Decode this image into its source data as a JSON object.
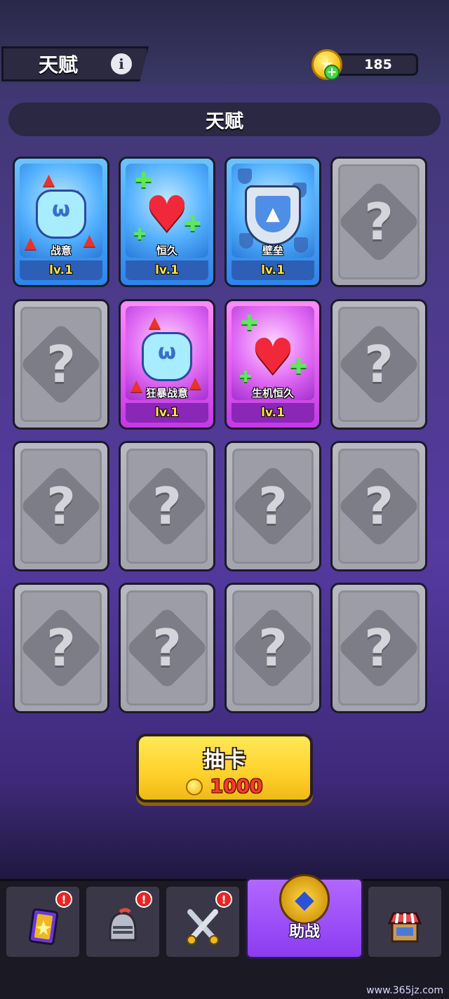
{
  "header": {
    "title": "天赋",
    "coins": "185"
  },
  "section": {
    "title": "天赋"
  },
  "cards": [
    {
      "name": "战意",
      "level": "lv.1",
      "rarity": "blue",
      "art": "fist"
    },
    {
      "name": "恒久",
      "level": "lv.1",
      "rarity": "blue",
      "art": "heart"
    },
    {
      "name": "壁垒",
      "level": "lv.1",
      "rarity": "blue",
      "art": "shield"
    },
    {
      "name": "",
      "level": "",
      "rarity": "locked",
      "art": "question"
    },
    {
      "name": "",
      "level": "",
      "rarity": "locked",
      "art": "question"
    },
    {
      "name": "狂暴战意",
      "level": "lv.1",
      "rarity": "purple",
      "art": "fist"
    },
    {
      "name": "生机恒久",
      "level": "lv.1",
      "rarity": "purple",
      "art": "heart"
    },
    {
      "name": "",
      "level": "",
      "rarity": "locked",
      "art": "question"
    },
    {
      "name": "",
      "level": "",
      "rarity": "locked",
      "art": "question"
    },
    {
      "name": "",
      "level": "",
      "rarity": "locked",
      "art": "question"
    },
    {
      "name": "",
      "level": "",
      "rarity": "locked",
      "art": "question"
    },
    {
      "name": "",
      "level": "",
      "rarity": "locked",
      "art": "question"
    },
    {
      "name": "",
      "level": "",
      "rarity": "locked",
      "art": "question"
    },
    {
      "name": "",
      "level": "",
      "rarity": "locked",
      "art": "question"
    },
    {
      "name": "",
      "level": "",
      "rarity": "locked",
      "art": "question"
    },
    {
      "name": "",
      "level": "",
      "rarity": "locked",
      "art": "question"
    }
  ],
  "locked_symbol": "?",
  "draw_button": {
    "label": "抽卡",
    "cost": "1000"
  },
  "nav": {
    "items": [
      {
        "icon": "card-icon",
        "badge": "!"
      },
      {
        "icon": "helmet-icon",
        "badge": "!"
      },
      {
        "icon": "crossed-swords-icon",
        "badge": "!"
      },
      {
        "icon": "pentagram-emblem-icon",
        "label": "助战",
        "active": true
      },
      {
        "icon": "shop-icon"
      }
    ]
  },
  "watermark": "www.365jz.com",
  "colors": {
    "blue_card": "#2d84ea",
    "purple_card": "#c437e6",
    "locked_card": "#a4a4ae",
    "draw_button": "#ffd12a",
    "cost_text": "#ff3b2a",
    "active_nav": "#8a3cf0"
  }
}
